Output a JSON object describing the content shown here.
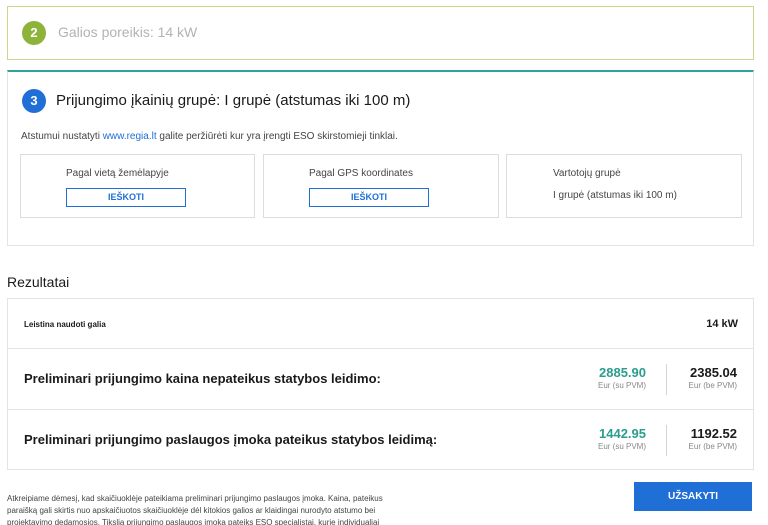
{
  "step2": {
    "number": "2",
    "title": "Galios poreikis: 14 kW"
  },
  "step3": {
    "number": "3",
    "title": "Prijungimo įkainių grupė: I grupė (atstumas iki 100 m)",
    "info_prefix": "Atstumui nustatyti ",
    "info_link": "www.regia.lt",
    "info_suffix": " galite peržiūrėti kur yra įrengti ESO skirstomieji tinklai.",
    "cards": {
      "map": {
        "label": "Pagal vietą žemėlapyje",
        "button": "IEŠKOTI"
      },
      "gps": {
        "label": "Pagal GPS koordinates",
        "button": "IEŠKOTI"
      },
      "group": {
        "label": "Vartotojų grupė",
        "value": "I grupė (atstumas iki 100 m)"
      }
    }
  },
  "results": {
    "heading": "Rezultatai",
    "allowed_power": {
      "label": "Leistina naudoti galia",
      "value": "14 kW"
    },
    "without_permit": {
      "label": "Preliminari prijungimo kaina nepateikus statybos leidimo:",
      "vat_value": "2885.90",
      "vat_unit": "Eur (su PVM)",
      "novat_value": "2385.04",
      "novat_unit": "Eur (be PVM)"
    },
    "with_permit": {
      "label": "Preliminari prijungimo paslaugos įmoka pateikus statybos leidimą:",
      "vat_value": "1442.95",
      "vat_unit": "Eur (su PVM)",
      "novat_value": "1192.52",
      "novat_unit": "Eur (be PVM)"
    }
  },
  "footer": {
    "disclaimer": "Atkreipiame dėmesį, kad skaičiuoklėje pateikiama preliminari prijungimo paslaugos įmoka. Kaina, pateikus paraišką gali skirtis nuo apskaičiuotos skaičiuoklėje dėl kitokios galios ar klaidingai nurodyto atstumo bei projektavimo dedamosios. Tikslią prijungimo paslaugos įmoką pateiks ESO specialistai, kurie individualiai",
    "order_button": "UŽSAKYTI"
  },
  "colors": {
    "accent_blue": "#1f6fd6",
    "step2_green": "#8db33a",
    "teal_price": "#2a9d8f",
    "step3_border": "#2fa39a"
  }
}
